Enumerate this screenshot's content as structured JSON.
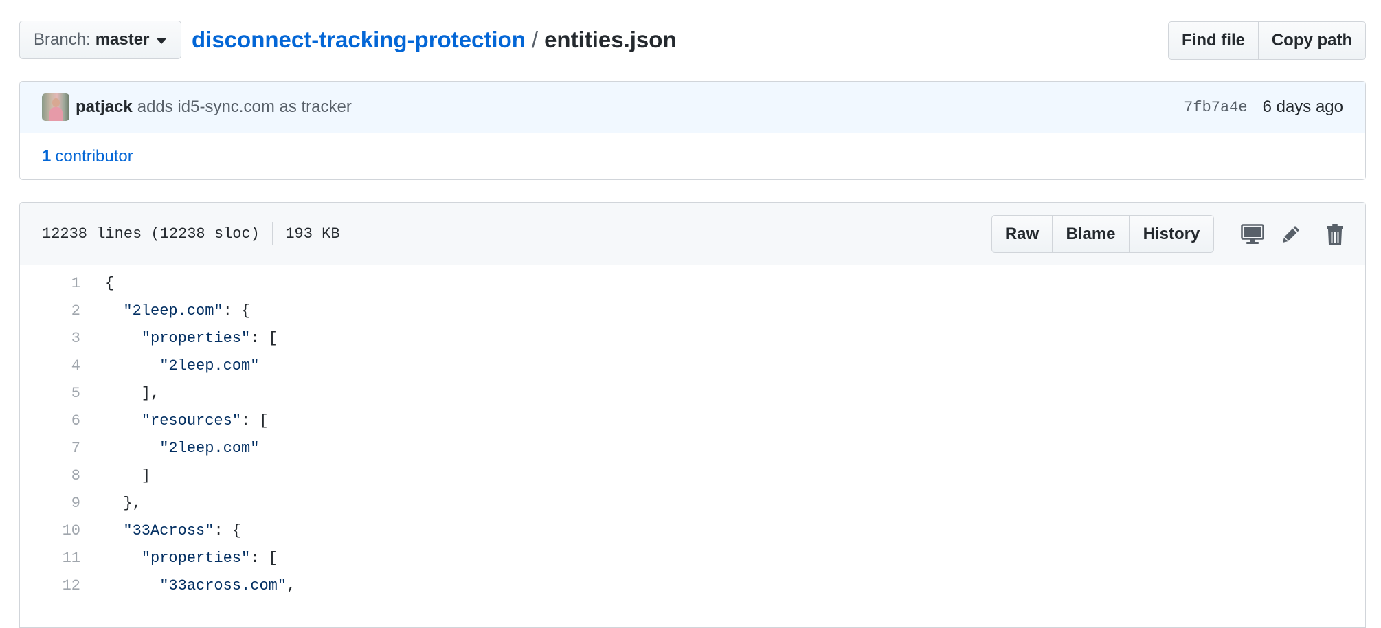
{
  "topbar": {
    "branch_prefix": "Branch:",
    "branch_name": "master",
    "repo_name": "disconnect-tracking-protection",
    "separator": "/",
    "file_name": "entities.json",
    "find_file_label": "Find file",
    "copy_path_label": "Copy path"
  },
  "commit": {
    "author": "patjack",
    "message": "adds id5-sync.com as tracker",
    "sha": "7fb7a4e",
    "time": "6 days ago"
  },
  "contributors": {
    "count": "1",
    "label": "contributor"
  },
  "file": {
    "lines_info": "12238 lines (12238 sloc)",
    "size": "193 KB",
    "raw_label": "Raw",
    "blame_label": "Blame",
    "history_label": "History",
    "icons": {
      "desktop": "desktop-icon",
      "edit": "pencil-icon",
      "delete": "trash-icon"
    }
  },
  "code_lines": [
    {
      "n": "1",
      "pre": "{",
      "str": "",
      "post": ""
    },
    {
      "n": "2",
      "pre": "  ",
      "str": "\"2leep.com\"",
      "post": ": {"
    },
    {
      "n": "3",
      "pre": "    ",
      "str": "\"properties\"",
      "post": ": ["
    },
    {
      "n": "4",
      "pre": "      ",
      "str": "\"2leep.com\"",
      "post": ""
    },
    {
      "n": "5",
      "pre": "    ],",
      "str": "",
      "post": ""
    },
    {
      "n": "6",
      "pre": "    ",
      "str": "\"resources\"",
      "post": ": ["
    },
    {
      "n": "7",
      "pre": "      ",
      "str": "\"2leep.com\"",
      "post": ""
    },
    {
      "n": "8",
      "pre": "    ]",
      "str": "",
      "post": ""
    },
    {
      "n": "9",
      "pre": "  },",
      "str": "",
      "post": ""
    },
    {
      "n": "10",
      "pre": "  ",
      "str": "\"33Across\"",
      "post": ": {"
    },
    {
      "n": "11",
      "pre": "    ",
      "str": "\"properties\"",
      "post": ": ["
    },
    {
      "n": "12",
      "pre": "      ",
      "str": "\"33across.com\"",
      "post": ","
    }
  ],
  "colors": {
    "link": "#0366d6",
    "text": "#24292e",
    "muted": "#586069",
    "border": "#d1d5da",
    "commit_bg": "#f1f8ff",
    "header_bg": "#f6f8fa",
    "string": "#032f62",
    "line_number": "#a0a6ad"
  }
}
